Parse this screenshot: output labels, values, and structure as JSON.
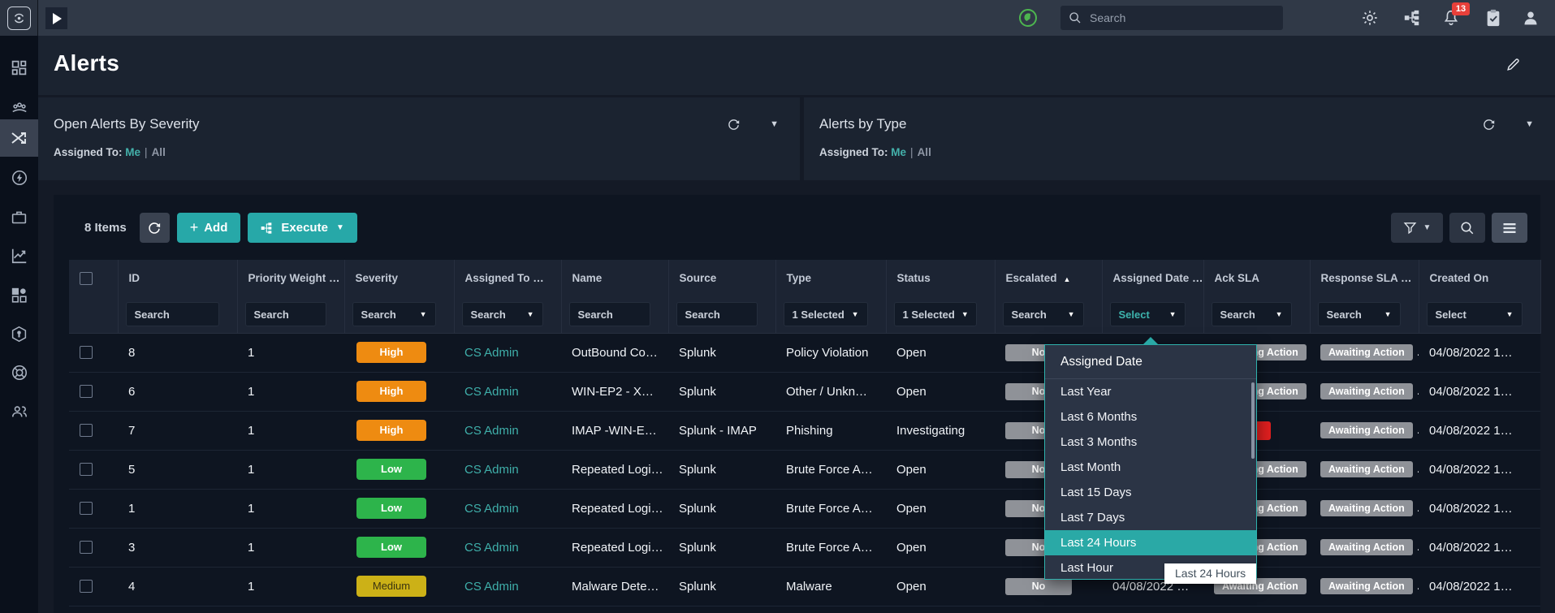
{
  "topbar": {
    "search_placeholder": "Search",
    "notification_count": "13"
  },
  "page": {
    "title": "Alerts"
  },
  "panels": [
    {
      "title": "Open Alerts By Severity",
      "assigned_label": "Assigned To:",
      "me": "Me",
      "divider": "|",
      "all": "All"
    },
    {
      "title": "Alerts by Type",
      "assigned_label": "Assigned To:",
      "me": "Me",
      "divider": "|",
      "all": "All"
    }
  ],
  "toolbar": {
    "items_count": "8 Items",
    "add_label": "Add",
    "execute_label": "Execute"
  },
  "colors": {
    "accent_teal": "#27a8a8",
    "severity_high": "#ee8b11",
    "severity_low": "#2db44b",
    "severity_medium": "#ccb117",
    "sla_gray": "#8f9298",
    "sla_red": "#df1f1f",
    "notification_red": "#e8403a"
  },
  "table": {
    "columns": [
      {
        "key": "checkbox",
        "label": "",
        "filter": "checkbox"
      },
      {
        "key": "id",
        "label": "ID",
        "filter": "search"
      },
      {
        "key": "priority_weight",
        "label": "Priority Weight …",
        "filter": "search"
      },
      {
        "key": "severity",
        "label": "Severity",
        "filter": "search_dd"
      },
      {
        "key": "assigned_to",
        "label": "Assigned To …",
        "filter": "search_dd"
      },
      {
        "key": "name",
        "label": "Name",
        "filter": "search"
      },
      {
        "key": "source",
        "label": "Source",
        "filter": "search"
      },
      {
        "key": "type",
        "label": "Type",
        "filter": "selected_dd",
        "filter_value": "1 Selected"
      },
      {
        "key": "status",
        "label": "Status",
        "filter": "selected_dd",
        "filter_value": "1 Selected"
      },
      {
        "key": "escalated",
        "label": "Escalated",
        "sort": "asc",
        "filter": "search_dd"
      },
      {
        "key": "assigned_date",
        "label": "Assigned Date …",
        "filter": "select_dd",
        "filter_value": "Select",
        "active": true
      },
      {
        "key": "ack_sla",
        "label": "Ack SLA",
        "filter": "search_dd"
      },
      {
        "key": "response_sla",
        "label": "Response SLA …",
        "filter": "search_dd"
      },
      {
        "key": "created_on",
        "label": "Created On",
        "filter": "select_dd",
        "filter_value": "Select"
      }
    ],
    "search_filter_label": "Search",
    "rows": [
      {
        "id": "8",
        "priority_weight": "1",
        "severity": "High",
        "severity_level": "high",
        "assigned_to": "CS Admin",
        "name": "OutBound Co…",
        "source": "Splunk",
        "type": "Policy Violation",
        "status": "Open",
        "escalated": "No",
        "assigned_date": "",
        "ack_sla": {
          "label": "Awaiting Action",
          "variant": "gray",
          "suffix": "."
        },
        "response_sla": {
          "label": "Awaiting Action",
          "variant": "gray",
          "suffix": "."
        },
        "created_on": "04/08/2022 1…"
      },
      {
        "id": "6",
        "priority_weight": "1",
        "severity": "High",
        "severity_level": "high",
        "assigned_to": "CS Admin",
        "name": "WIN-EP2 - X…",
        "source": "Splunk",
        "type": "Other / Unkn…",
        "status": "Open",
        "escalated": "No",
        "assigned_date": "",
        "ack_sla": {
          "label": "Awaiting Action",
          "variant": "gray",
          "suffix": "."
        },
        "response_sla": {
          "label": "Awaiting Action",
          "variant": "gray",
          "suffix": "."
        },
        "created_on": "04/08/2022 1…"
      },
      {
        "id": "7",
        "priority_weight": "1",
        "severity": "High",
        "severity_level": "high",
        "assigned_to": "CS Admin",
        "name": "IMAP -WIN-E…",
        "source": "Splunk - IMAP",
        "type": "Phishing",
        "status": "Investigating",
        "escalated": "No",
        "assigned_date": "",
        "ack_sla": {
          "label": "",
          "variant": "red",
          "suffix": ""
        },
        "response_sla": {
          "label": "Awaiting Action",
          "variant": "gray",
          "suffix": "."
        },
        "created_on": "04/08/2022 1…"
      },
      {
        "id": "5",
        "priority_weight": "1",
        "severity": "Low",
        "severity_level": "low",
        "assigned_to": "CS Admin",
        "name": "Repeated Logi…",
        "source": "Splunk",
        "type": "Brute Force A…",
        "status": "Open",
        "escalated": "No",
        "assigned_date": "",
        "ack_sla": {
          "label": "Awaiting Action",
          "variant": "gray",
          "suffix": "."
        },
        "response_sla": {
          "label": "Awaiting Action",
          "variant": "gray",
          "suffix": "."
        },
        "created_on": "04/08/2022 1…"
      },
      {
        "id": "1",
        "priority_weight": "1",
        "severity": "Low",
        "severity_level": "low",
        "assigned_to": "CS Admin",
        "name": "Repeated Logi…",
        "source": "Splunk",
        "type": "Brute Force A…",
        "status": "Open",
        "escalated": "No",
        "assigned_date": "",
        "ack_sla": {
          "label": "Awaiting Action",
          "variant": "gray",
          "suffix": "."
        },
        "response_sla": {
          "label": "Awaiting Action",
          "variant": "gray",
          "suffix": "."
        },
        "created_on": "04/08/2022 1…"
      },
      {
        "id": "3",
        "priority_weight": "1",
        "severity": "Low",
        "severity_level": "low",
        "assigned_to": "CS Admin",
        "name": "Repeated Logi…",
        "source": "Splunk",
        "type": "Brute Force A…",
        "status": "Open",
        "escalated": "No",
        "assigned_date": "",
        "ack_sla": {
          "label": "Awaiting Action",
          "variant": "gray",
          "suffix": "."
        },
        "response_sla": {
          "label": "Awaiting Action",
          "variant": "gray",
          "suffix": "."
        },
        "created_on": "04/08/2022 1…"
      },
      {
        "id": "4",
        "priority_weight": "1",
        "severity": "Medium",
        "severity_level": "medium",
        "assigned_to": "CS Admin",
        "name": "Malware Dete…",
        "source": "Splunk",
        "type": "Malware",
        "status": "Open",
        "escalated": "No",
        "assigned_date": "04/08/2022 …",
        "ack_sla": {
          "label": "Awaiting Action",
          "variant": "gray",
          "suffix": "."
        },
        "response_sla": {
          "label": "Awaiting Action",
          "variant": "gray",
          "suffix": "."
        },
        "created_on": "04/08/2022 1…"
      }
    ]
  },
  "dropdown": {
    "title": "Assigned Date",
    "items": [
      "Last Year",
      "Last 6 Months",
      "Last 3 Months",
      "Last Month",
      "Last 15 Days",
      "Last 7 Days",
      "Last 24 Hours",
      "Last Hour"
    ],
    "selected": "Last 24 Hours",
    "tooltip": "Last 24 Hours"
  }
}
